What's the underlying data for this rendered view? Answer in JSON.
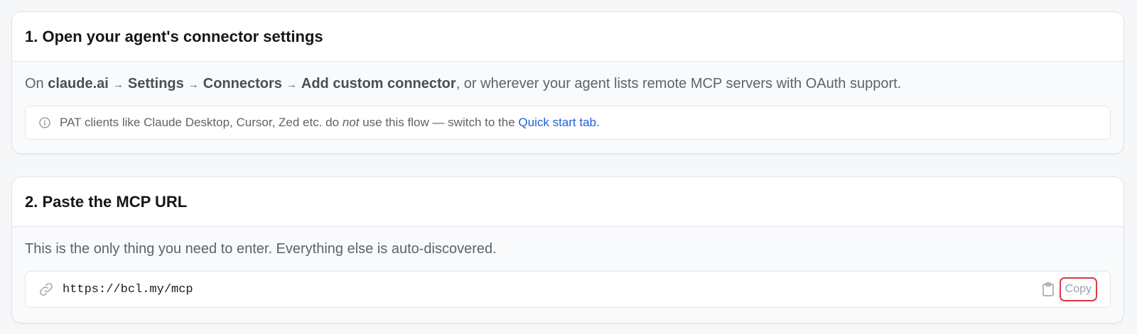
{
  "step1": {
    "title": "1. Open your agent's connector settings",
    "desc_prefix": "On ",
    "path": [
      "claude.ai",
      "Settings",
      "Connectors",
      "Add custom connector"
    ],
    "arrow": "→",
    "desc_suffix": ", or wherever your agent lists remote MCP servers with OAuth support.",
    "notice": {
      "icon": "info-circle-icon",
      "text_before": "PAT clients like Claude Desktop, Cursor, Zed etc. do",
      "emphasis": "not",
      "text_after": "use this flow — switch to the",
      "link": "Quick start tab."
    }
  },
  "step2": {
    "title": "2. Paste the MCP URL",
    "desc": "This is the only thing you need to enter. Everything else is auto-discovered.",
    "url_icon": "link-icon",
    "url": "https://bcl.my/mcp",
    "copy_icon": "clipboard-icon",
    "copy_label": "Copy"
  },
  "colors": {
    "link": "#1f5fd6",
    "highlight_border": "#d93a45"
  }
}
